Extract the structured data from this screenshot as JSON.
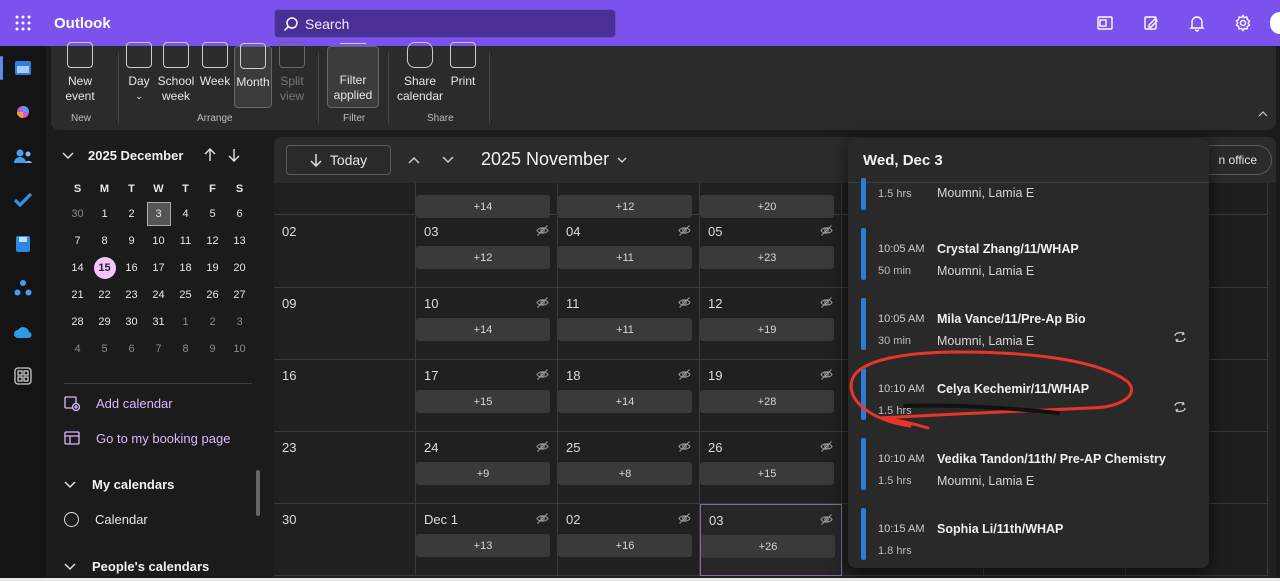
{
  "app": {
    "title": "Outlook"
  },
  "search": {
    "placeholder": "Search"
  },
  "ribbon": {
    "new_event": "New\nevent",
    "day": "Day",
    "school_week": "School\nweek",
    "week": "Week",
    "month": "Month",
    "split_view": "Split\nview",
    "filter": "Filter\napplied",
    "share_calendar": "Share\ncalendar",
    "print": "Print",
    "groups": {
      "new": "New",
      "arrange": "Arrange",
      "filter": "Filter",
      "share": "Share"
    }
  },
  "mini_calendar": {
    "title": "2025 December",
    "weekdays": [
      "S",
      "M",
      "T",
      "W",
      "T",
      "F",
      "S"
    ],
    "weeks": [
      [
        "30",
        "1",
        "2",
        "3",
        "4",
        "5",
        "6"
      ],
      [
        "7",
        "8",
        "9",
        "10",
        "11",
        "12",
        "13"
      ],
      [
        "14",
        "15",
        "16",
        "17",
        "18",
        "19",
        "20"
      ],
      [
        "21",
        "22",
        "23",
        "24",
        "25",
        "26",
        "27"
      ],
      [
        "28",
        "29",
        "30",
        "31",
        "1",
        "2",
        "3"
      ],
      [
        "4",
        "5",
        "6",
        "7",
        "8",
        "9",
        "10"
      ]
    ],
    "selected": "3",
    "today": "15"
  },
  "sidepanel": {
    "add_calendar": "Add calendar",
    "booking": "Go to my booking page",
    "my_calendars": "My calendars",
    "calendar": "Calendar",
    "peoples_calendars": "People's calendars"
  },
  "toolbar": {
    "today": "Today",
    "month_title": "2025 November",
    "office": "n office"
  },
  "grid": {
    "rows": [
      {
        "label": "",
        "cells": [
          {
            "day": "",
            "more": "+14"
          },
          {
            "day": "",
            "more": "+12"
          },
          {
            "day": "",
            "more": "+20"
          }
        ]
      },
      {
        "label": "02",
        "cells": [
          {
            "day": "03",
            "more": "+12"
          },
          {
            "day": "04",
            "more": "+11"
          },
          {
            "day": "05",
            "more": "+23"
          }
        ]
      },
      {
        "label": "09",
        "cells": [
          {
            "day": "10",
            "more": "+14"
          },
          {
            "day": "11",
            "more": "+11"
          },
          {
            "day": "12",
            "more": "+19"
          }
        ]
      },
      {
        "label": "16",
        "cells": [
          {
            "day": "17",
            "more": "+15"
          },
          {
            "day": "18",
            "more": "+14"
          },
          {
            "day": "19",
            "more": "+28"
          }
        ]
      },
      {
        "label": "23",
        "cells": [
          {
            "day": "24",
            "more": "+9"
          },
          {
            "day": "25",
            "more": "+8"
          },
          {
            "day": "26",
            "more": "+15"
          }
        ]
      },
      {
        "label": "30",
        "cells": [
          {
            "day": "Dec 1",
            "more": "+13"
          },
          {
            "day": "02",
            "more": "+16"
          },
          {
            "day": "03",
            "more": "+26"
          }
        ]
      }
    ]
  },
  "popup": {
    "title": "Wed, Dec 3",
    "events": [
      {
        "time": "",
        "duration": "1.5 hrs",
        "title": "",
        "organizer": "Moumni, Lamia E",
        "recurring": false
      },
      {
        "time": "10:05 AM",
        "duration": "50 min",
        "title": "Crystal Zhang/11/WHAP",
        "organizer": "Moumni, Lamia E",
        "recurring": false
      },
      {
        "time": "10:05 AM",
        "duration": "30 min",
        "title": "Mila Vance/11/Pre-Ap Bio",
        "organizer": "Moumni, Lamia E",
        "recurring": true
      },
      {
        "time": "10:10 AM",
        "duration": "1.5 hrs",
        "title": "Celya Kechemir/11/WHAP",
        "organizer": "",
        "recurring": true
      },
      {
        "time": "10:10 AM",
        "duration": "1.5 hrs",
        "title": "Vedika Tandon/11th/ Pre-AP Chemistry",
        "organizer": "Moumni, Lamia E",
        "recurring": false
      },
      {
        "time": "10:15 AM",
        "duration": "1.8 hrs",
        "title": "Sophia Li/11th/WHAP",
        "organizer": "",
        "recurring": false
      }
    ]
  },
  "colors": {
    "brand": "#7b52ee",
    "event_bar": "#2a7cd6",
    "annotation": "#e8352a",
    "today": "#f4c6ff"
  }
}
